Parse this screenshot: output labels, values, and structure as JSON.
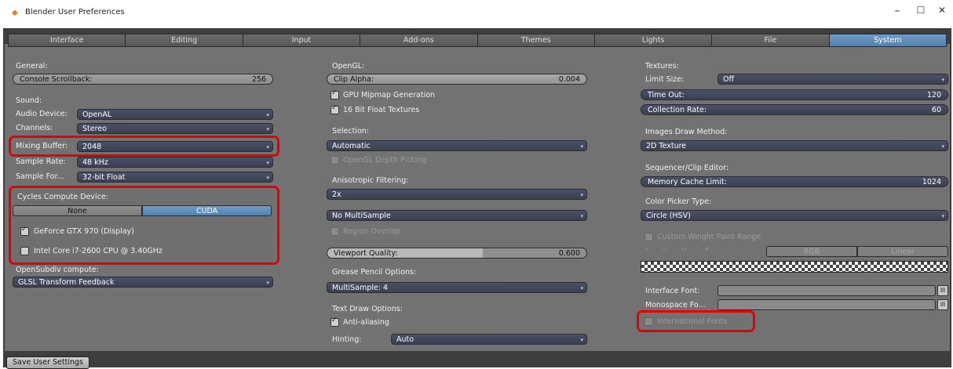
{
  "window": {
    "title": "Blender User Preferences",
    "minimize": "–",
    "maximize": "☐",
    "close": "✕"
  },
  "tabs": [
    {
      "label": "Interface"
    },
    {
      "label": "Editing"
    },
    {
      "label": "Input"
    },
    {
      "label": "Add-ons"
    },
    {
      "label": "Themes"
    },
    {
      "label": "Lights"
    },
    {
      "label": "File"
    },
    {
      "label": "System",
      "active": true
    }
  ],
  "col1": {
    "general_label": "General:",
    "console_label": "Console Scrollback:",
    "console_value": "256",
    "sound_label": "Sound:",
    "audio_device_label": "Audio Device:",
    "audio_device_value": "OpenAL",
    "channels_label": "Channels:",
    "channels_value": "Stereo",
    "mixing_buffer_label": "Mixing Buffer:",
    "mixing_buffer_value": "2048",
    "sample_rate_label": "Sample Rate:",
    "sample_rate_value": "48 kHz",
    "sample_format_label": "Sample For...",
    "sample_format_value": "32-bit Float",
    "cycles_label": "Cycles Compute Device:",
    "cycles_none": "None",
    "cycles_cuda": "CUDA",
    "device1": "GeForce GTX 970 (Display)",
    "device2": "Intel Core i7-2600 CPU @ 3.40GHz",
    "opensubdiv_label": "OpenSubdiv compute:",
    "opensubdiv_value": "GLSL Transform Feedback"
  },
  "col2": {
    "opengl_label": "OpenGL:",
    "clip_alpha_label": "Clip Alpha:",
    "clip_alpha_value": "0.004",
    "gpu_mipmap": "GPU Mipmap Generation",
    "float_textures": "16 Bit Float Textures",
    "selection_label": "Selection:",
    "selection_value": "Automatic",
    "depth_picking": "OpenGL Depth Picking",
    "aniso_label": "Anisotropic Filtering:",
    "aniso_value": "2x",
    "multisample_value": "No MultiSample",
    "region_overlap": "Region Overlap",
    "viewport_quality_label": "Viewport Quality:",
    "viewport_quality_value": "0.600",
    "grease_label": "Grease Pencil Options:",
    "grease_value": "MultiSample: 4",
    "text_draw_label": "Text Draw Options:",
    "antialiasing": "Anti-aliasing",
    "hinting_label": "Hinting:",
    "hinting_value": "Auto"
  },
  "col3": {
    "textures_label": "Textures:",
    "limit_size_label": "Limit Size:",
    "limit_size_value": "Off",
    "timeout_label": "Time Out:",
    "timeout_value": "120",
    "collection_label": "Collection Rate:",
    "collection_value": "60",
    "images_draw_label": "Images Draw Method:",
    "images_draw_value": "2D Texture",
    "sequencer_label": "Sequencer/Clip Editor:",
    "memory_cache_label": "Memory Cache Limit:",
    "memory_cache_value": "1024",
    "color_picker_label": "Color Picker Type:",
    "color_picker_value": "Circle (HSV)",
    "custom_weight": "Custom Weight Paint Range",
    "ramp_rgb": "RGB",
    "ramp_linear": "Linear",
    "interface_font_label": "Interface Font:",
    "monospace_font_label": "Monospace Fo...",
    "international_fonts": "International Fonts"
  },
  "footer": {
    "save_label": "Save User Settings"
  }
}
